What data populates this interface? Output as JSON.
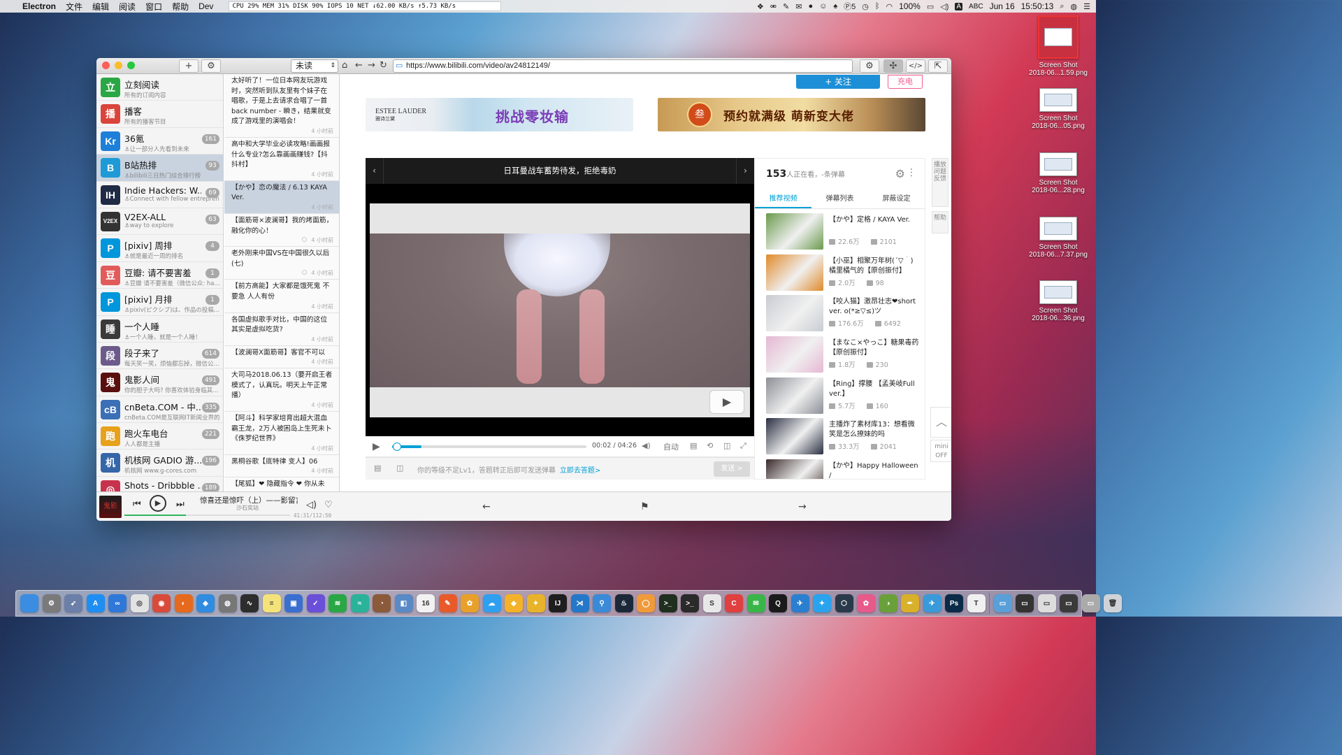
{
  "menubar": {
    "app_name": "Electron",
    "menus": [
      "文件",
      "编辑",
      "阅读",
      "窗口",
      "帮助",
      "Dev"
    ],
    "stats": "CPU 29%   MEM 31%   DISK 90% IOPS 10   NET ↓62.00 KB/s ↑5.73 KB/s",
    "status_icons": [
      "dropbox-icon",
      "nosleep-icon",
      "tag-icon",
      "wechat-icon",
      "notification-icon",
      "mascot-icon",
      "qq-icon",
      "p5-icon",
      "time-machine-icon",
      "bluetooth-icon",
      "wifi-icon"
    ],
    "p5_label": "5",
    "battery": "100%",
    "input_icon": "A",
    "input_label": "ABC",
    "date": "Jun 16",
    "time": "15:50:13"
  },
  "desktop": {
    "files": [
      {
        "name": "Screen Shot",
        "detail": "2018-06...1.59.png"
      },
      {
        "name": "Screen Shot",
        "detail": "2018-06...05.png"
      },
      {
        "name": "Screen Shot",
        "detail": "2018-06...28.png"
      },
      {
        "name": "Screen Shot",
        "detail": "2018-06...7.37.png"
      },
      {
        "name": "Screen Shot",
        "detail": "2018-06...36.png"
      }
    ]
  },
  "toolbar": {
    "add_icon": "+",
    "settings_icon": "⚙",
    "filter_value": "未读",
    "url": "https://www.bilibili.com/video/av24812149/"
  },
  "feeds": [
    {
      "title": "立刻阅读",
      "sub": "所有的订阅内容",
      "badge": "",
      "color": "#2aa745",
      "glyph": "立"
    },
    {
      "title": "播客",
      "sub": "所有的播客节目",
      "badge": "",
      "color": "#d9443b",
      "glyph": "播"
    },
    {
      "title": "36氪",
      "sub": "⚓让一部分人先看到未来",
      "badge": "161",
      "color": "#1e7fd8",
      "glyph": "Kr"
    },
    {
      "title": "B站热排",
      "sub": "⚓bilibili三日热门综合排行榜",
      "badge": "93",
      "color": "#1e9bd6",
      "glyph": "B"
    },
    {
      "title": "Indie Hackers: W...",
      "sub": "⚓Connect with fellow entreprene...",
      "badge": "69",
      "color": "#1f2a44",
      "glyph": "IH"
    },
    {
      "title": "V2EX-ALL",
      "sub": "⚓way to explore",
      "badge": "63",
      "color": "#333333",
      "glyph": "V2EX"
    },
    {
      "title": "[pixiv] 周排",
      "sub": "⚓就是最近一周的排名",
      "badge": "4",
      "color": "#0096db",
      "glyph": "P"
    },
    {
      "title": "豆瓣: 请不要害羞",
      "sub": "⚓豆瓣 请不要害羞（微信公众: ha...",
      "badge": "1",
      "color": "#e25b5b",
      "glyph": "豆"
    },
    {
      "title": "[pixiv] 月排",
      "sub": "⚓pixiv(ピクシブ)は、作品の投稿...",
      "badge": "1",
      "color": "#0096db",
      "glyph": "P"
    },
    {
      "title": "一个人睡",
      "sub": "⚓一个人睡，就是一个人睡！",
      "badge": "",
      "color": "#3a3a3a",
      "glyph": "睡"
    },
    {
      "title": "段子来了",
      "sub": "每天笑一笑，烦恼都忘掉，微信公...",
      "badge": "614",
      "color": "#6c5b8a",
      "glyph": "段"
    },
    {
      "title": "鬼影人间",
      "sub": "你的胆子大吗? 你喜欢体验身临其...",
      "badge": "491",
      "color": "#5a0f0f",
      "glyph": "鬼"
    },
    {
      "title": "cnBeta.COM - 中...",
      "sub": "cnBeta.COM是互联网IT新闻业界的...",
      "badge": "335",
      "color": "#3b6fb6",
      "glyph": "cB"
    },
    {
      "title": "跑火车电台",
      "sub": "人人都是主播",
      "badge": "221",
      "color": "#e7a11a",
      "glyph": "跑"
    },
    {
      "title": "机核网 GADIO 游...",
      "sub": "机核网 www.g-cores.com",
      "badge": "196",
      "color": "#3566a8",
      "glyph": "机"
    },
    {
      "title": "Shots - Dribbble ...",
      "sub": "",
      "badge": "189",
      "color": "#c7334c",
      "glyph": "◎"
    }
  ],
  "articles": [
    {
      "text": "太好听了！一位日本网友玩游戏时，突然听到队友里有个妹子在唱歌，于是上去请求合唱了一首back number - 瞬き，结果就变成了游戏里的演唱会！",
      "time": "4 小时前"
    },
    {
      "text": "高中和大学毕业必读攻略!画画报什么专业?怎么靠画画赚钱?【抖抖村】",
      "time": "4 小时前"
    },
    {
      "text": "【かや】恋の魔法 / 6.13 KAYA Ver.",
      "time": "4 小时前"
    },
    {
      "text": "【面筋哥×波澜哥】我的烤面筋，融化你的心！",
      "time": "4 小时前"
    },
    {
      "text": "老外刚来中国VS在中国很久以后(七)",
      "time": "4 小时前"
    },
    {
      "text": "【前方高能】大家都是饿死鬼 不要急 人人有份",
      "time": "4 小时前"
    },
    {
      "text": "各国虚拟歌手对比，中国的这位其实是虚拟吃货?",
      "time": "4 小时前"
    },
    {
      "text": "【波澜哥X面筋哥】客官不可以",
      "time": "4 小时前"
    },
    {
      "text": "大司马2018.06.13（要开启王者模式了，认真玩。明天上午正常播）",
      "time": "4 小时前"
    },
    {
      "text": "【阿斗】科学家培育出超大混血霸王龙，2万人被困岛上生死未卜《侏罗纪世界》",
      "time": "4 小时前"
    },
    {
      "text": "黑桐谷歌【底特律 变人】06",
      "time": "4 小时前"
    },
    {
      "text": "【尾狐】❤ 隐藏指令 ❤ 你从未",
      "time": ""
    }
  ],
  "page": {
    "follow": "+ 关注",
    "charge": "充电",
    "ad1_brand": "ESTEE LAUDER",
    "ad1_brand_cn": "雅诗兰黛",
    "ad1_text": "挑战零妆输",
    "ad2_emblem": "叁",
    "ad2_text": "预约就满级  萌新变大佬"
  },
  "player": {
    "title": "日耳曼战车蓄势待发，拒绝毒奶",
    "current": "00:02",
    "duration": "04:26",
    "progress": 0.15,
    "auto_label": "自动",
    "danmu_tip": "你的等级不足Lv1，答题转正后即可发送弹幕",
    "danmu_link": "立即去答题>",
    "send": "发送 >"
  },
  "recommend": {
    "viewers": "153",
    "viewers_suffix": "人正在看，-条弹幕",
    "tabs": [
      "推荐视频",
      "弹幕列表",
      "屏蔽设定"
    ],
    "videos": [
      {
        "title": "【かや】定格 / KAYA Ver.",
        "plays": "22.6万",
        "danmaku": "2101",
        "color": "#6a9a4c"
      },
      {
        "title": "【小巫】相聚万年树(´▽｀) 橘里橘气的【原创振付】",
        "plays": "2.0万",
        "danmaku": "98",
        "color": "#e08a2a"
      },
      {
        "title": "【咬人猫】激昂壮志❤short ver. o(*≥▽≤)ツ",
        "plays": "176.6万",
        "danmaku": "6492",
        "color": "#c8ccd2"
      },
      {
        "title": "【まなこ×やっこ】糖果毒药【原创振付】",
        "plays": "1.8万",
        "danmaku": "230",
        "color": "#e6b7d3"
      },
      {
        "title": "【Ring】撑腰 【孟美岐Full ver.】",
        "plays": "5.7万",
        "danmaku": "160",
        "color": "#8c8f96"
      },
      {
        "title": "主播炸了素材库13：想看微笑是怎么撩妹的吗",
        "plays": "33.3万",
        "danmaku": "2041",
        "color": "#2a2f42"
      },
      {
        "title": "【かや】Happy Halloween /",
        "plays": "",
        "danmaku": "",
        "color": "#3a2a2a"
      }
    ],
    "side_tab": "播放问题反馈",
    "side_help": "帮助",
    "mini_label": "mini",
    "mini_state": "OFF"
  },
  "audio": {
    "cover_text": "鬼影",
    "title": "惊喜还是惊吓（上）——影留言",
    "artist": "沙石奕站",
    "elapsed": "41:31",
    "total": "112:50",
    "progress": 0.37
  },
  "dock": [
    {
      "name": "finder",
      "color": "#3a8de0",
      "glyph": ""
    },
    {
      "name": "preferences",
      "color": "#7a7a7a",
      "glyph": "⚙"
    },
    {
      "name": "rocket",
      "color": "#6b7fa8",
      "glyph": "➶"
    },
    {
      "name": "app-store",
      "color": "#1f8ef2",
      "glyph": "A"
    },
    {
      "name": "fluid",
      "color": "#2f78d8",
      "glyph": "∞"
    },
    {
      "name": "photo-booth",
      "color": "#e3e3e3",
      "glyph": "◎"
    },
    {
      "name": "chrome",
      "color": "#d84b3a",
      "glyph": "◉"
    },
    {
      "name": "firefox",
      "color": "#e66a1d",
      "glyph": "◐"
    },
    {
      "name": "safari",
      "color": "#2f8ce0",
      "glyph": "◈"
    },
    {
      "name": "disk-utility",
      "color": "#777777",
      "glyph": "◍"
    },
    {
      "name": "activity-monitor",
      "color": "#2d2d2d",
      "glyph": "∿"
    },
    {
      "name": "notes",
      "color": "#f4e27a",
      "glyph": "≡"
    },
    {
      "name": "screens",
      "color": "#3a6fd0",
      "glyph": "▣"
    },
    {
      "name": "things",
      "color": "#6a4fd8",
      "glyph": "✓"
    },
    {
      "name": "reader",
      "color": "#2aa745",
      "glyph": "≋"
    },
    {
      "name": "coda",
      "color": "#2bb39a",
      "glyph": "≈"
    },
    {
      "name": "owl",
      "color": "#8a5a3a",
      "glyph": "◔"
    },
    {
      "name": "preview",
      "color": "#5a8ac6",
      "glyph": "◧"
    },
    {
      "name": "calendar",
      "color": "#f2f2f2",
      "glyph": "16"
    },
    {
      "name": "pencil",
      "color": "#e85a2a",
      "glyph": "✎"
    },
    {
      "name": "bee",
      "color": "#e8a02a",
      "glyph": "✿"
    },
    {
      "name": "messages",
      "color": "#2fa0f0",
      "glyph": "☁"
    },
    {
      "name": "sketch",
      "color": "#f3b22a",
      "glyph": "◆"
    },
    {
      "name": "butterfly",
      "color": "#e8b32a",
      "glyph": "✦"
    },
    {
      "name": "intellij",
      "color": "#1e1e1e",
      "glyph": "IJ"
    },
    {
      "name": "vscode",
      "color": "#2578c8",
      "glyph": "⋊"
    },
    {
      "name": "maps",
      "color": "#3a8ad8",
      "glyph": "⚲"
    },
    {
      "name": "steam",
      "color": "#1b2838",
      "glyph": "♨"
    },
    {
      "name": "balloon",
      "color": "#f09a3a",
      "glyph": "◯"
    },
    {
      "name": "terminal-green",
      "color": "#1f2f1f",
      "glyph": ">_"
    },
    {
      "name": "terminal",
      "color": "#2a2a2a",
      "glyph": ">_"
    },
    {
      "name": "scrivener",
      "color": "#e8e8e8",
      "glyph": "S"
    },
    {
      "name": "c-app",
      "color": "#e04040",
      "glyph": "C"
    },
    {
      "name": "wechat",
      "color": "#3ab54a",
      "glyph": "✉"
    },
    {
      "name": "qq",
      "color": "#1a1a1a",
      "glyph": "Q"
    },
    {
      "name": "bird",
      "color": "#2a7fd0",
      "glyph": "✈"
    },
    {
      "name": "twitter",
      "color": "#2aa3ef",
      "glyph": "✦"
    },
    {
      "name": "hex",
      "color": "#2a3a4a",
      "glyph": "⬡"
    },
    {
      "name": "photos",
      "color": "#e85a8a",
      "glyph": "✿"
    },
    {
      "name": "chameleon",
      "color": "#6aa03a",
      "glyph": "◑"
    },
    {
      "name": "sketchbook",
      "color": "#d8b02a",
      "glyph": "✒"
    },
    {
      "name": "plane",
      "color": "#3a9ad8",
      "glyph": "✈"
    },
    {
      "name": "photoshop",
      "color": "#0a2a48",
      "glyph": "Ps"
    },
    {
      "name": "textedit",
      "color": "#f0f0f0",
      "glyph": "T"
    },
    {
      "name": "folder",
      "color": "#5a9fd8",
      "glyph": "▭"
    },
    {
      "name": "desktop",
      "color": "#333333",
      "glyph": "▭"
    },
    {
      "name": "screens-stack",
      "color": "#dddddd",
      "glyph": "▭"
    },
    {
      "name": "monitor",
      "color": "#3a3a3a",
      "glyph": "▭"
    },
    {
      "name": "stack",
      "color": "#aaaaaa",
      "glyph": "▭"
    },
    {
      "name": "trash",
      "color": "#cfd3d8",
      "glyph": "🗑"
    }
  ]
}
